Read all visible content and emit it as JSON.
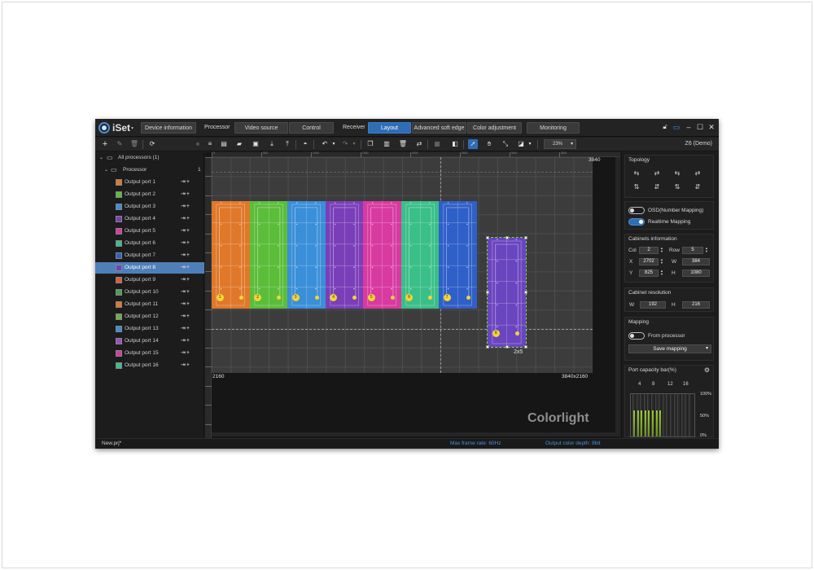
{
  "app": {
    "name": "iSet"
  },
  "titlebar": {
    "device_info": "Device information",
    "processor": "Processor",
    "video_source": "Video source",
    "control": "Control",
    "receiver": "Receiver",
    "layout": "Layout",
    "advanced_soft_edge": "Advanced soft edge",
    "color_adjustment": "Color adjustment",
    "monitoring": "Monitoring"
  },
  "toolbar": {
    "zoom": "23%",
    "model": "Z6 (Demo)"
  },
  "tree": {
    "all_processors": "All processors (1)",
    "processor": "Processor",
    "processor_count": "1",
    "ports": [
      {
        "label": "Output port 1",
        "color": "#e0782a"
      },
      {
        "label": "Output port 2",
        "color": "#5bbd3a"
      },
      {
        "label": "Output port 3",
        "color": "#3a8fd8"
      },
      {
        "label": "Output port 4",
        "color": "#7a3fb8"
      },
      {
        "label": "Output port 5",
        "color": "#d83aa0"
      },
      {
        "label": "Output port 6",
        "color": "#3abf88"
      },
      {
        "label": "Output port 7",
        "color": "#2f5fc8"
      },
      {
        "label": "Output port 8",
        "color": "#6a45c0"
      },
      {
        "label": "Output port 9",
        "color": "#e05a3a"
      },
      {
        "label": "Output port 10",
        "color": "#4aa05a"
      },
      {
        "label": "Output port 11",
        "color": "#e0782a"
      },
      {
        "label": "Output port 12",
        "color": "#6ab04a"
      },
      {
        "label": "Output port 13",
        "color": "#3a8fd8"
      },
      {
        "label": "Output port 14",
        "color": "#9a4fc8"
      },
      {
        "label": "Output port 15",
        "color": "#d83aa0"
      },
      {
        "label": "Output port 16",
        "color": "#3abf88"
      }
    ]
  },
  "canvas": {
    "width_label": "3840",
    "height_label": "2160",
    "resolution_label": "3840x2160",
    "size_label": "2x5",
    "brand": "Colorlight",
    "ruler_marks": [
      "0",
      "500",
      "1000",
      "1500",
      "2000",
      "2500",
      "3000",
      "3500"
    ],
    "port_numbers": [
      "1",
      "2",
      "3",
      "4",
      "5",
      "6",
      "7",
      "8"
    ]
  },
  "right": {
    "topology_title": "Topology",
    "osd_label": "OSD(Number Mapping)",
    "realtime_label": "Realtime Mapping",
    "cabinets_title": "Cabinets information",
    "col_label": "Col",
    "col": "2",
    "row_label": "Row",
    "row": "5",
    "x_label": "X",
    "x": "2702",
    "w_label": "W",
    "w": "384",
    "y_label": "Y",
    "y": "825",
    "h_label": "H",
    "h": "1080",
    "resolution_title": "Cabinet resolution",
    "res_w_label": "W",
    "res_w": "192",
    "res_h_label": "H",
    "res_h": "216",
    "mapping_title": "Mapping",
    "from_processor": "From processor",
    "save_mapping": "Save mapping",
    "capacity_title": "Port capacity bar(%)",
    "capacity_cols": [
      "4",
      "8",
      "12",
      "16"
    ],
    "capacity_pcts": [
      "100%",
      "50%",
      "0%"
    ],
    "capacity_values": [
      0.62,
      0.62,
      0.62,
      0.62,
      0.62,
      0.62,
      0.62,
      0.62,
      0,
      0,
      0,
      0,
      0,
      0,
      0,
      0
    ]
  },
  "status": {
    "file": "New.prj*",
    "frame_rate": "Max frame rate: 60Hz",
    "color_depth": "Output color depth: 8bit"
  },
  "colors": {
    "accent": "#2f6db5",
    "status_text": "#4a8fd8"
  }
}
